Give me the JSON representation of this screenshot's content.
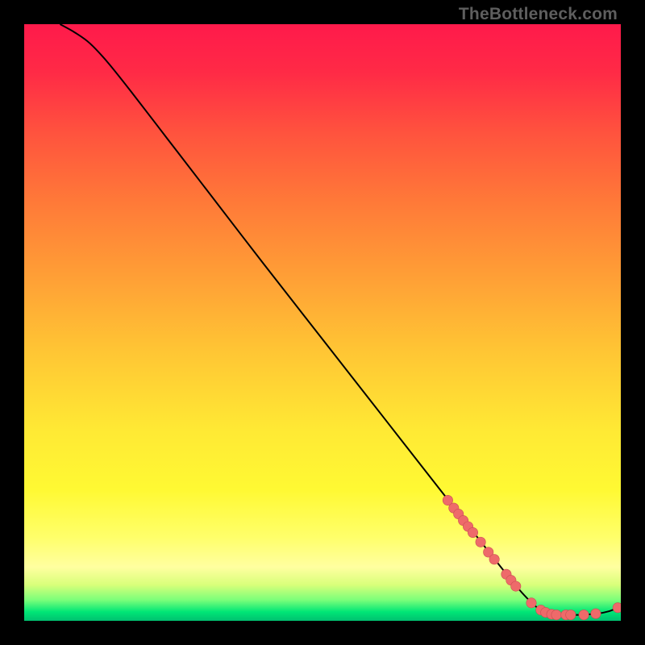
{
  "watermark": "TheBottleneck.com",
  "colors": {
    "curve": "#000000",
    "point_fill": "#ee6a6a",
    "point_stroke": "#c94f52"
  },
  "chart_data": {
    "type": "line",
    "title": "",
    "xlabel": "",
    "ylabel": "",
    "xlim": [
      0,
      100
    ],
    "ylim": [
      0,
      100
    ],
    "curve": [
      {
        "x": 6.0,
        "y": 100.0
      },
      {
        "x": 8.5,
        "y": 98.6
      },
      {
        "x": 11.0,
        "y": 96.8
      },
      {
        "x": 14.0,
        "y": 93.6
      },
      {
        "x": 18.0,
        "y": 88.6
      },
      {
        "x": 24.0,
        "y": 80.8
      },
      {
        "x": 30.0,
        "y": 73.0
      },
      {
        "x": 40.0,
        "y": 60.0
      },
      {
        "x": 50.0,
        "y": 47.2
      },
      {
        "x": 60.0,
        "y": 34.4
      },
      {
        "x": 70.0,
        "y": 21.6
      },
      {
        "x": 78.0,
        "y": 11.4
      },
      {
        "x": 83.0,
        "y": 5.2
      },
      {
        "x": 86.0,
        "y": 2.2
      },
      {
        "x": 88.0,
        "y": 1.2
      },
      {
        "x": 90.0,
        "y": 1.0
      },
      {
        "x": 93.0,
        "y": 1.0
      },
      {
        "x": 96.0,
        "y": 1.2
      },
      {
        "x": 98.0,
        "y": 1.6
      },
      {
        "x": 99.5,
        "y": 2.2
      }
    ],
    "points": [
      {
        "x": 71.0,
        "y": 20.2
      },
      {
        "x": 72.0,
        "y": 18.9
      },
      {
        "x": 72.8,
        "y": 17.9
      },
      {
        "x": 73.6,
        "y": 16.8
      },
      {
        "x": 74.4,
        "y": 15.8
      },
      {
        "x": 75.2,
        "y": 14.8
      },
      {
        "x": 76.5,
        "y": 13.2
      },
      {
        "x": 77.8,
        "y": 11.5
      },
      {
        "x": 78.8,
        "y": 10.3
      },
      {
        "x": 80.8,
        "y": 7.8
      },
      {
        "x": 81.6,
        "y": 6.8
      },
      {
        "x": 82.4,
        "y": 5.8
      },
      {
        "x": 85.0,
        "y": 3.0
      },
      {
        "x": 86.6,
        "y": 1.8
      },
      {
        "x": 87.4,
        "y": 1.4
      },
      {
        "x": 88.4,
        "y": 1.1
      },
      {
        "x": 89.2,
        "y": 1.0
      },
      {
        "x": 90.8,
        "y": 1.0
      },
      {
        "x": 91.6,
        "y": 1.0
      },
      {
        "x": 93.8,
        "y": 1.0
      },
      {
        "x": 95.8,
        "y": 1.2
      },
      {
        "x": 99.5,
        "y": 2.2
      }
    ]
  }
}
